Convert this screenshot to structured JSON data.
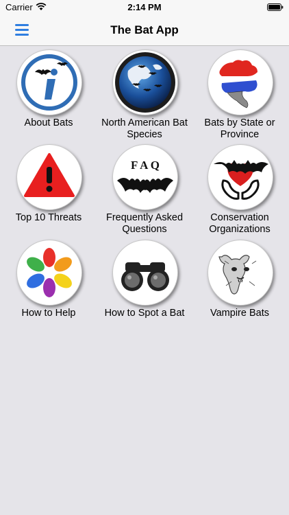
{
  "status_bar": {
    "carrier": "Carrier",
    "time": "2:14 PM"
  },
  "nav": {
    "title": "The Bat App",
    "menu_icon": "hamburger-menu-icon"
  },
  "tiles": [
    {
      "label": "About Bats",
      "icon": "info-bat-icon"
    },
    {
      "label": "North American Bat Species",
      "icon": "globe-bats-icon"
    },
    {
      "label": "Bats by State or Province",
      "icon": "north-america-map-icon"
    },
    {
      "label": "Top 10 Threats",
      "icon": "warning-triangle-icon"
    },
    {
      "label": "Frequently Asked Questions",
      "icon": "faq-bat-icon"
    },
    {
      "label": "Conservation Organizations",
      "icon": "heart-hands-bat-icon"
    },
    {
      "label": "How to Help",
      "icon": "colorful-hands-icon"
    },
    {
      "label": "How to Spot a Bat",
      "icon": "binoculars-icon"
    },
    {
      "label": "Vampire Bats",
      "icon": "vampire-bat-sketch-icon"
    }
  ],
  "faq_letters": "F A Q"
}
